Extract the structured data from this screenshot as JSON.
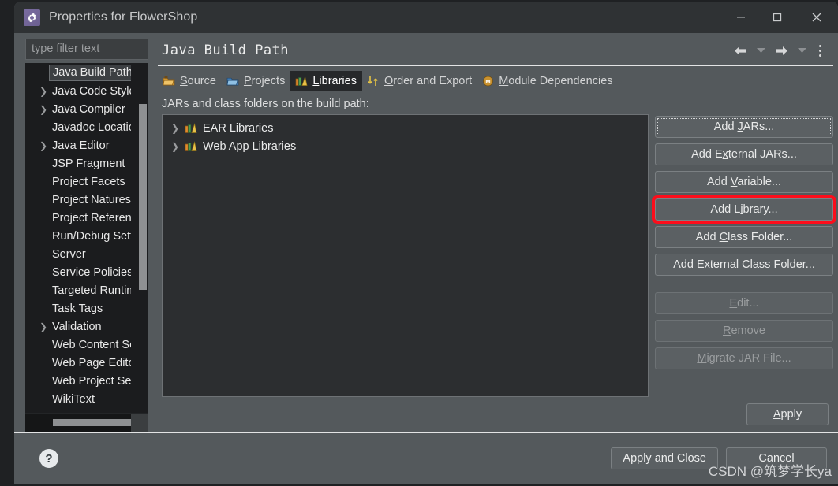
{
  "window": {
    "title": "Properties for FlowerShop",
    "icon": "gear-icon",
    "minimize": "–",
    "maximize": "□",
    "close": "✕"
  },
  "sidebar": {
    "filter_placeholder": "type filter text",
    "items": [
      {
        "label": "Java Build Path",
        "expandable": false,
        "selected": true
      },
      {
        "label": "Java Code Style",
        "expandable": true,
        "selected": false
      },
      {
        "label": "Java Compiler",
        "expandable": true,
        "selected": false
      },
      {
        "label": "Javadoc Location",
        "expandable": false,
        "selected": false
      },
      {
        "label": "Java Editor",
        "expandable": true,
        "selected": false
      },
      {
        "label": "JSP Fragment",
        "expandable": false,
        "selected": false
      },
      {
        "label": "Project Facets",
        "expandable": false,
        "selected": false
      },
      {
        "label": "Project Natures",
        "expandable": false,
        "selected": false
      },
      {
        "label": "Project References",
        "expandable": false,
        "selected": false
      },
      {
        "label": "Run/Debug Settings",
        "expandable": false,
        "selected": false
      },
      {
        "label": "Server",
        "expandable": false,
        "selected": false
      },
      {
        "label": "Service Policies",
        "expandable": false,
        "selected": false
      },
      {
        "label": "Targeted Runtimes",
        "expandable": false,
        "selected": false
      },
      {
        "label": "Task Tags",
        "expandable": false,
        "selected": false
      },
      {
        "label": "Validation",
        "expandable": true,
        "selected": false
      },
      {
        "label": "Web Content Settings",
        "expandable": false,
        "selected": false
      },
      {
        "label": "Web Page Editor",
        "expandable": false,
        "selected": false
      },
      {
        "label": "Web Project Settings",
        "expandable": false,
        "selected": false
      },
      {
        "label": "WikiText",
        "expandable": false,
        "selected": false
      }
    ]
  },
  "page": {
    "title": "Java Build Path",
    "nav": {
      "back": "back-arrow",
      "back_menu": "chevron-down",
      "forward": "forward-arrow",
      "forward_menu": "chevron-down",
      "menu": "kebab-menu"
    }
  },
  "tabs": [
    {
      "label": "Source",
      "mnemonic": "S",
      "icon": "source-folder-icon",
      "active": false
    },
    {
      "label": "Projects",
      "mnemonic": "P",
      "icon": "projects-folder-icon",
      "active": false
    },
    {
      "label": "Libraries",
      "mnemonic": "L",
      "icon": "libraries-icon",
      "active": true
    },
    {
      "label": "Order and Export",
      "mnemonic": "O",
      "icon": "order-export-icon",
      "active": false
    },
    {
      "label": "Module Dependencies",
      "mnemonic": "M",
      "icon": "module-icon",
      "active": false
    }
  ],
  "main": {
    "section_label": "JARs and class folders on the build path:",
    "entries": [
      {
        "label": "EAR Libraries",
        "icon": "libraries-icon",
        "expandable": true
      },
      {
        "label": "Web App Libraries",
        "icon": "libraries-icon",
        "expandable": true
      }
    ],
    "buttons": [
      {
        "label": "Add JARs...",
        "mnemonic": "J",
        "pre": "Add ",
        "post": "ARs...",
        "state": "focused"
      },
      {
        "label": "Add External JARs...",
        "mnemonic": "x",
        "pre": "Add E",
        "post": "ternal JARs...",
        "state": "normal"
      },
      {
        "label": "Add Variable...",
        "mnemonic": "V",
        "pre": "Add ",
        "post": "ariable...",
        "state": "normal"
      },
      {
        "label": "Add Library...",
        "mnemonic": "i",
        "pre": "Add L",
        "post": "brary...",
        "state": "highlight"
      },
      {
        "label": "Add Class Folder...",
        "mnemonic": "C",
        "pre": "Add ",
        "post": "lass Folder...",
        "state": "normal"
      },
      {
        "label": "Add External Class Folder...",
        "mnemonic": "d",
        "pre": "Add External Class Fol",
        "post": "er...",
        "state": "normal"
      }
    ],
    "buttons_lower": [
      {
        "label": "Edit...",
        "mnemonic": "E",
        "pre": "",
        "post": "dit...",
        "state": "disabled"
      },
      {
        "label": "Remove",
        "mnemonic": "R",
        "pre": "",
        "post": "emove",
        "state": "disabled"
      },
      {
        "label": "Migrate JAR File...",
        "mnemonic": "M",
        "pre": "",
        "post": "igrate JAR File...",
        "state": "disabled"
      }
    ],
    "apply_label": "Apply",
    "apply_mnemonic": "A"
  },
  "footer": {
    "help": "?",
    "apply_and_close": "Apply and Close",
    "cancel": "Cancel"
  },
  "watermark": "CSDN @筑梦学长ya",
  "colors": {
    "dialog_bg": "#54595c",
    "titlebar_bg": "#2f3234",
    "tree_bg": "#1b1c1e",
    "list_bg": "#2c2e30",
    "button_bg": "#5b6063",
    "highlight_red": "#fc0d1b",
    "accent_line": "#e3e4e5"
  }
}
